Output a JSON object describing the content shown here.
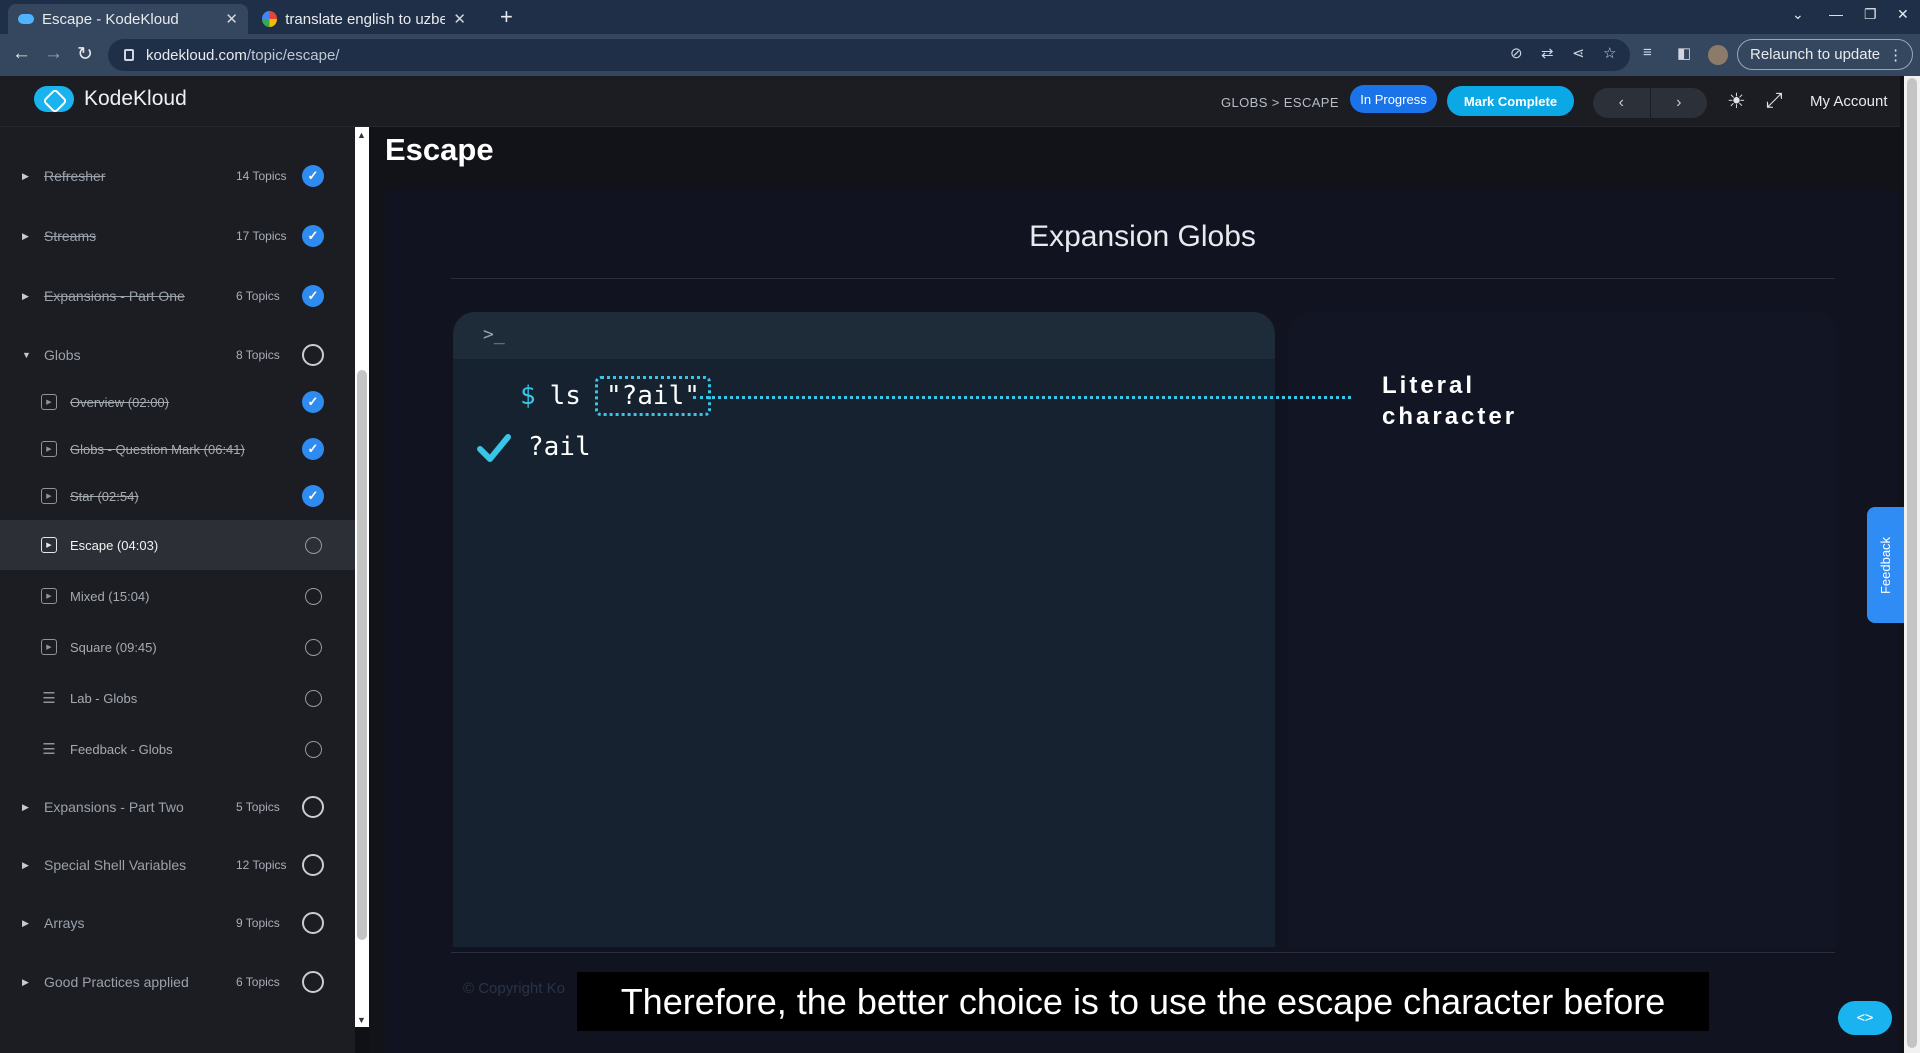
{
  "browser": {
    "tabs": [
      {
        "title": "Escape - KodeKloud",
        "active": true
      },
      {
        "title": "translate english to uzbek",
        "active": false
      }
    ],
    "url_host": "kodekloud.com",
    "url_path": "/topic/escape/",
    "relaunch_label": "Relaunch to update"
  },
  "header": {
    "brand": "KodeKloud",
    "breadcrumb": "GLOBS > ESCAPE",
    "status_badge": "In Progress",
    "mark_complete": "Mark Complete",
    "prev": "‹",
    "next": "›",
    "my_account": "My Account"
  },
  "sidebar": {
    "sections_top": [
      {
        "label": "Refresher",
        "count": "14 Topics",
        "done": true
      },
      {
        "label": "Streams",
        "count": "17 Topics",
        "done": true
      },
      {
        "label": "Expansions - Part One",
        "count": "6 Topics",
        "done": true
      },
      {
        "label": "Globs",
        "count": "8 Topics",
        "done": false
      }
    ],
    "items": [
      {
        "label": "Overview (02:00)",
        "done": true,
        "kind": "video"
      },
      {
        "label": "Globs - Question Mark (06:41)",
        "done": true,
        "kind": "video"
      },
      {
        "label": "Star (02:54)",
        "done": true,
        "kind": "video"
      },
      {
        "label": "Escape (04:03)",
        "done": false,
        "kind": "video",
        "active": true
      },
      {
        "label": "Mixed (15:04)",
        "done": false,
        "kind": "video"
      },
      {
        "label": "Square (09:45)",
        "done": false,
        "kind": "video"
      },
      {
        "label": "Lab - Globs",
        "done": false,
        "kind": "lab"
      },
      {
        "label": "Feedback - Globs",
        "done": false,
        "kind": "lab"
      }
    ],
    "sections_bottom": [
      {
        "label": "Expansions - Part Two",
        "count": "5 Topics"
      },
      {
        "label": "Special Shell Variables",
        "count": "12 Topics"
      },
      {
        "label": "Arrays",
        "count": "9 Topics"
      },
      {
        "label": "Good Practices applied",
        "count": "6 Topics"
      }
    ]
  },
  "page": {
    "title": "Escape"
  },
  "slide": {
    "title": "Expansion Globs",
    "prompt_symbol": ">_",
    "dollar": "$",
    "command": "ls",
    "argument": "\"?ail\"",
    "output": "?ail",
    "annotation_line1": "Literal",
    "annotation_line2": "character",
    "copyright": "© Copyright Ko",
    "caption": "Therefore, the better choice is to use the escape character before"
  },
  "feedback_tab": "Feedback",
  "colors": {
    "accent_blue": "#2e8bf0",
    "mark_complete": "#0aa9e6",
    "terminal_accent": "#38c6e8"
  }
}
